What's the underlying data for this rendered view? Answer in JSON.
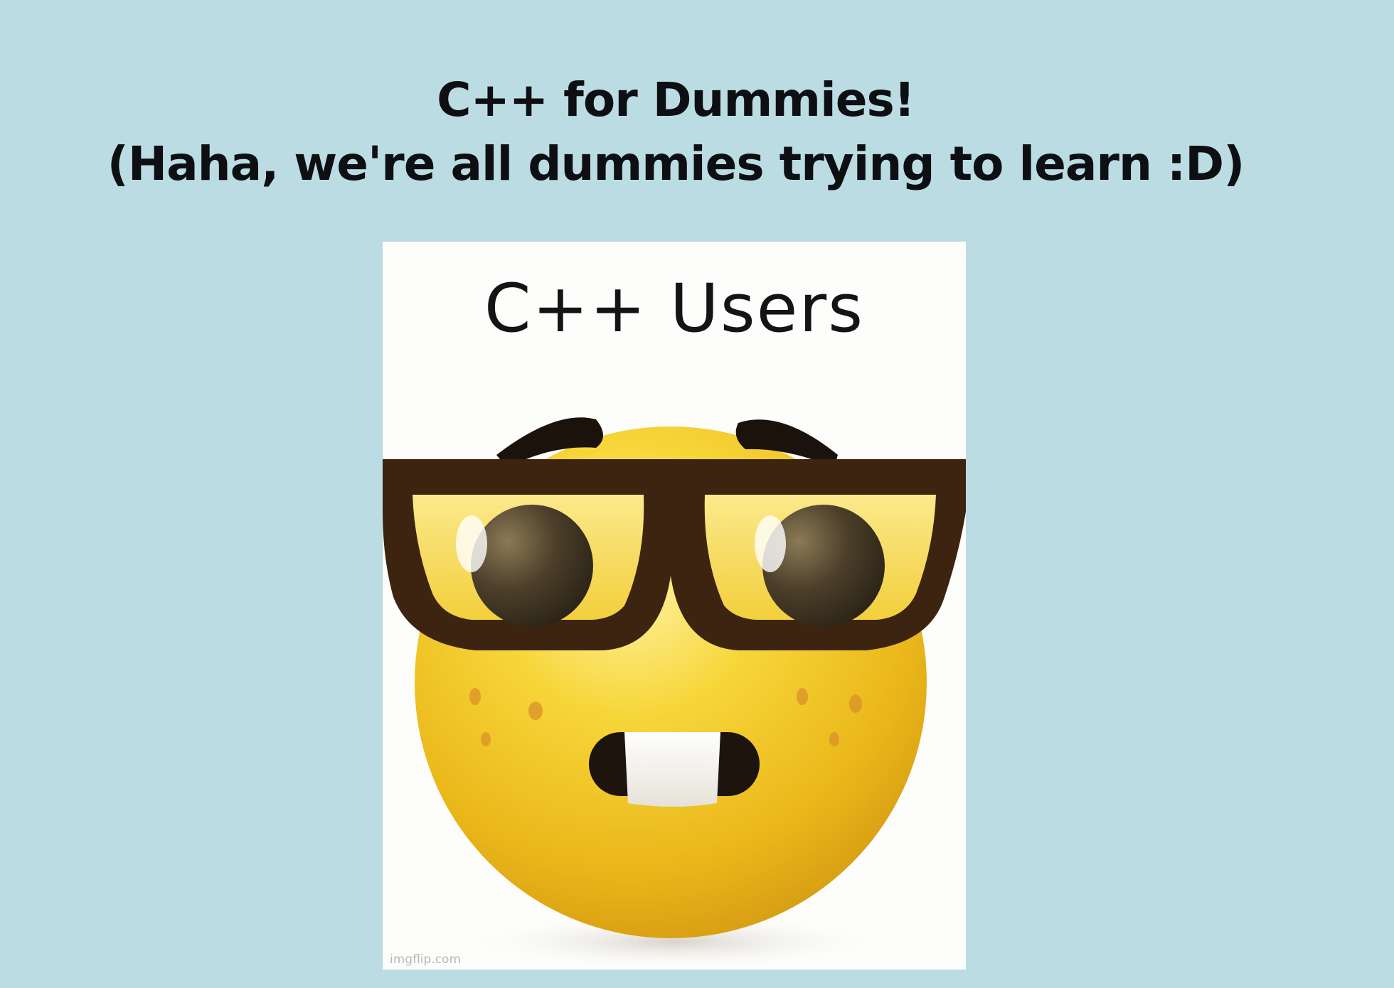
{
  "slide": {
    "title_line1": "C++ for Dummies!",
    "title_line2": "(Haha, we're all dummies trying to learn :D)"
  },
  "meme": {
    "caption": "C++ Users",
    "icon": "nerd-face-emoji",
    "watermark": "imgflip.com"
  },
  "colors": {
    "background": "#bcdce4",
    "title_text": "#0d0f12",
    "emoji_face": "#f3c51f",
    "glasses": "#3d2411"
  }
}
